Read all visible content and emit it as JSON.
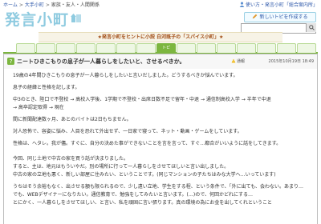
{
  "breadcrumb": {
    "items": [
      "ホーム",
      "大手小町",
      "家族・友人・人間関係"
    ]
  },
  "utility": {
    "link_label": "使い方・発言小町「総合案内所」"
  },
  "logo": {
    "text": "発言小町"
  },
  "new_topic": {
    "label": "新しいトピを作成する"
  },
  "search": {
    "placeholder": ""
  },
  "banner": {
    "text": "★発言小町をヒントに小説 白河既子の「スパイス小町」★"
  },
  "tabs": [
    "",
    "",
    "",
    "",
    "",
    "",
    "",
    "トピ",
    "",
    "",
    "",
    "",
    "",
    "",
    ""
  ],
  "active_tab_index": 7,
  "post": {
    "title": "ニートひきこもりの息子が一人暮らしをしたいと、させるべきか。",
    "report_label": "通報",
    "date": "2015年10月19日 18:49",
    "paragraphs": [
      "19歳の4年間ひきこもりの息子が一人暮らしをしたいと言いだしました。どうするべきか悩んでいます。",
      "息子の経緯と性格を記します。",
      "中3のとき、陸口で不登校 → 高校入学後、1学期で不登校・出席日数不足で留年・中退 → 通信制高校入学 → 半年で中退",
      "→ 高卒認定取得 → 現在",
      "間に新聞配達数ヶ月、あとのバイトは2日もちません。",
      "対人恐怖で、容姿に悩み、人目を恐れて外出せず、一日家で寝って、ネット・動画・ゲームをしています。",
      "性格は、ヘタレ。我が儘。すぐに、自分の決めた事ができないことを言を言って、すぐ…都合がいいように話をしてきます。",
      "今回、同じ土地で中古の家を買う話が決まりました。",
      "すると、主は、地元はもういやだ。別の場所に行って一人暮らしをさせてほしいと言い出しました。",
      "中古の家の立地も悪く、新しい部屋に住みたい、ということです。(同じマンションの子たちはみな大学へ…いっています)",
      "うちはそう余裕もなく、出させる額も限られるので、少し遠い立地、学生をする程、という条件で、「外に出ても、会わない。あまり…",
      "でも、WEBデザイナーになりたい。通信教育で、勉強をしてみたいと言います。(…)ので、何回かどれにする…",
      "とにかく、一人暮らしをさせてほしい、と言い、私を頑固に言い張ります。真の環境の為にお金を出してくれということ"
    ]
  },
  "colors": {
    "accent_green": "#7cb63f",
    "logo_blue": "#8fcbe0",
    "link_blue": "#2a55a8",
    "banner_text": "#a04a12"
  }
}
